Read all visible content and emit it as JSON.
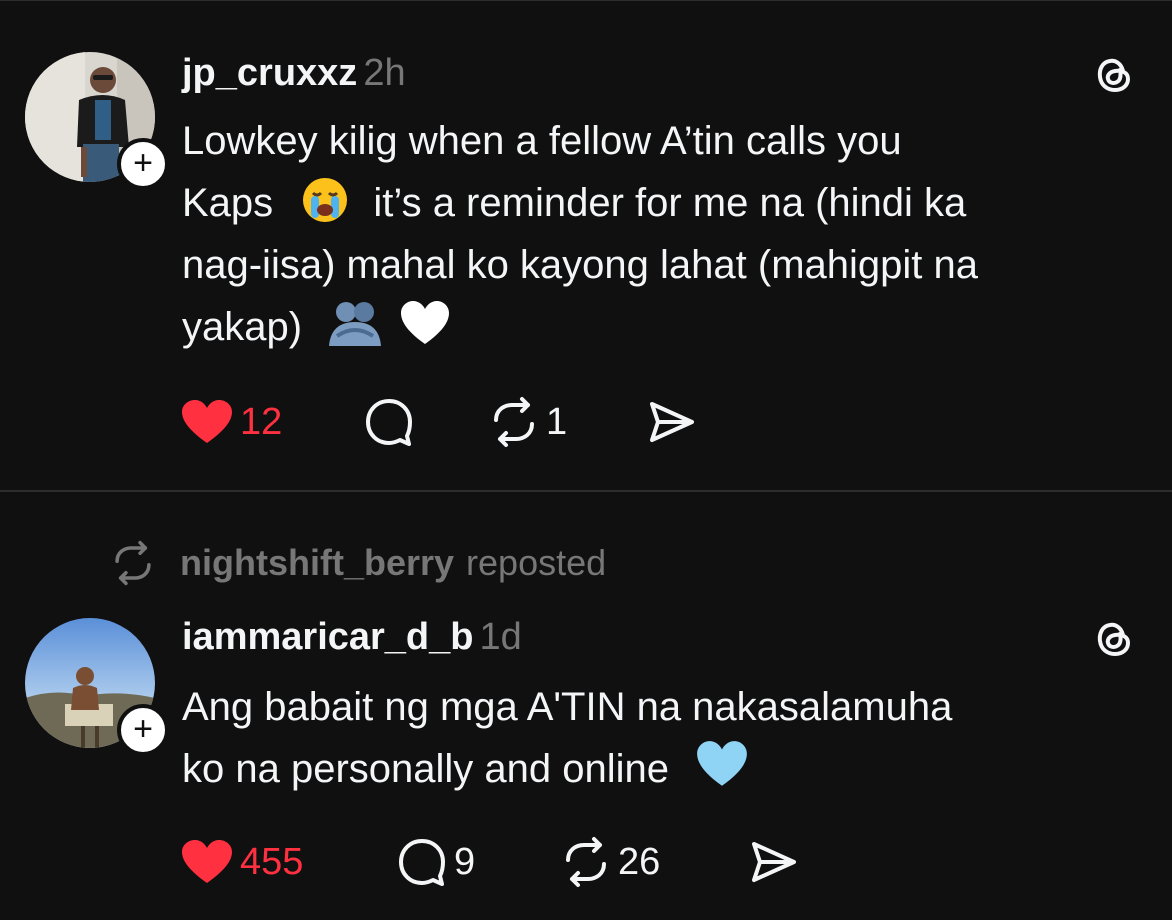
{
  "posts": [
    {
      "username": "jp_cruxxz",
      "time": "2h",
      "text_lines": [
        "Lowkey kilig when a fellow A’tin calls you",
        "Kaps",
        "it’s a reminder for me na (hindi ka",
        "nag-iisa) mahal ko kayong lahat (mahigpit na",
        "yakap)"
      ],
      "emojis": [
        "loudly-crying-face",
        "people-hugging",
        "white-heart"
      ],
      "likes": "12",
      "comments": "",
      "reposts": "1",
      "liked": true,
      "avatar_icon": "person-avatar",
      "follow_label": "+"
    },
    {
      "reposted_by": "nightshift_berry",
      "reposted_label": "reposted",
      "username": "iammaricar_d_b",
      "time": "1d",
      "text_lines": [
        "Ang babait ng mga A'TIN na nakasalamuha",
        "ko na personally and online"
      ],
      "emojis": [
        "light-blue-heart"
      ],
      "likes": "455",
      "comments": "9",
      "reposts": "26",
      "liked": true,
      "avatar_icon": "mountain-summit-avatar",
      "follow_label": "+"
    }
  ],
  "colors": {
    "background": "#101010",
    "like_red": "#ff3040",
    "muted_gray": "#777777",
    "text_white": "#f3f5f7"
  }
}
